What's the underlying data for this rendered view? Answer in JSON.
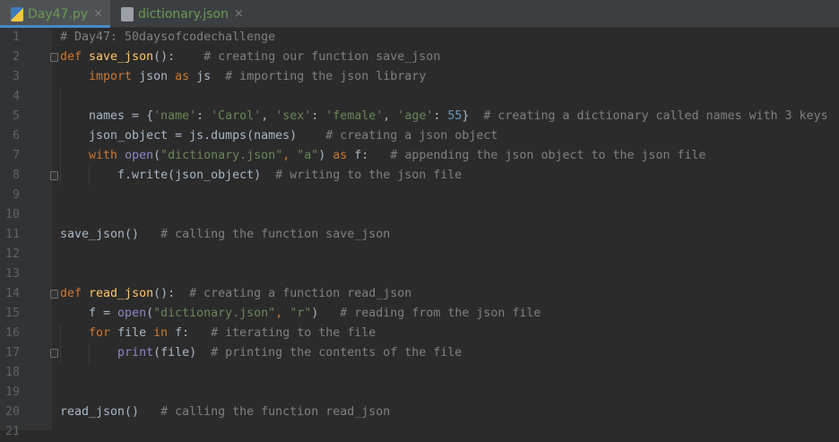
{
  "tabs": [
    {
      "label": "Day47.py",
      "icon": "python-file-icon",
      "active": true
    },
    {
      "label": "dictionary.json",
      "icon": "json-file-icon",
      "active": false
    }
  ],
  "close_glyph": "×",
  "colors": {
    "keyword": "#cc7832",
    "function": "#ffc66d",
    "string": "#6a8759",
    "comment": "#808080",
    "builtin": "#8888c6",
    "number": "#6897bb",
    "text": "#a9b7c6"
  },
  "lines": [
    {
      "n": "1",
      "tokens": [
        [
          "cm",
          "# Day47: 50daysofcodechallenge"
        ]
      ]
    },
    {
      "n": "2",
      "fold": true,
      "tokens": [
        [
          "kw",
          "def "
        ],
        [
          "fn",
          "save_json"
        ],
        [
          "tx",
          "():    "
        ],
        [
          "cm",
          "# creating our function save_json"
        ]
      ]
    },
    {
      "n": "3",
      "tokens": [
        [
          "tx",
          "    "
        ],
        [
          "kw",
          "import "
        ],
        [
          "tx",
          "json "
        ],
        [
          "kw",
          "as "
        ],
        [
          "tx",
          "js  "
        ],
        [
          "cm",
          "# importing the json library"
        ]
      ]
    },
    {
      "n": "4",
      "tokens": []
    },
    {
      "n": "5",
      "tokens": [
        [
          "tx",
          "    names = {"
        ],
        [
          "str",
          "'name'"
        ],
        [
          "tx",
          ": "
        ],
        [
          "str",
          "'Carol'"
        ],
        [
          "tx",
          ", "
        ],
        [
          "str",
          "'sex'"
        ],
        [
          "tx",
          ": "
        ],
        [
          "str",
          "'female'"
        ],
        [
          "tx",
          ", "
        ],
        [
          "str",
          "'age'"
        ],
        [
          "tx",
          ": "
        ],
        [
          "num",
          "55"
        ],
        [
          "tx",
          "}  "
        ],
        [
          "cm",
          "# creating a dictionary called names with 3 keys"
        ]
      ]
    },
    {
      "n": "6",
      "tokens": [
        [
          "tx",
          "    json_object = js.dumps(names)    "
        ],
        [
          "cm",
          "# creating a json object"
        ]
      ]
    },
    {
      "n": "7",
      "tokens": [
        [
          "tx",
          "    "
        ],
        [
          "kw",
          "with "
        ],
        [
          "bi",
          "open"
        ],
        [
          "tx",
          "("
        ],
        [
          "str",
          "\"dictionary.json\""
        ],
        [
          "kw",
          ", "
        ],
        [
          "str",
          "\"a\""
        ],
        [
          "tx",
          ") "
        ],
        [
          "kw",
          "as "
        ],
        [
          "tx",
          "f:   "
        ],
        [
          "cm",
          "# appending the json object to the json file"
        ]
      ]
    },
    {
      "n": "8",
      "fold": true,
      "tokens": [
        [
          "tx",
          "        f.write(json_object)  "
        ],
        [
          "cm",
          "# writing to the json file"
        ]
      ]
    },
    {
      "n": "9",
      "tokens": []
    },
    {
      "n": "10",
      "tokens": []
    },
    {
      "n": "11",
      "tokens": [
        [
          "tx",
          "save_json()   "
        ],
        [
          "cm",
          "# calling the function save_json"
        ]
      ]
    },
    {
      "n": "12",
      "tokens": []
    },
    {
      "n": "13",
      "tokens": []
    },
    {
      "n": "14",
      "fold": true,
      "tokens": [
        [
          "kw",
          "def "
        ],
        [
          "fn",
          "read_json"
        ],
        [
          "tx",
          "():  "
        ],
        [
          "cm",
          "# creating a function read_json"
        ]
      ]
    },
    {
      "n": "15",
      "tokens": [
        [
          "tx",
          "    f = "
        ],
        [
          "bi",
          "open"
        ],
        [
          "tx",
          "("
        ],
        [
          "str",
          "\"dictionary.json\""
        ],
        [
          "kw",
          ", "
        ],
        [
          "str",
          "\"r\""
        ],
        [
          "tx",
          ")   "
        ],
        [
          "cm",
          "# reading from the json file"
        ]
      ]
    },
    {
      "n": "16",
      "tokens": [
        [
          "tx",
          "    "
        ],
        [
          "kw",
          "for "
        ],
        [
          "tx",
          "file "
        ],
        [
          "kw",
          "in "
        ],
        [
          "tx",
          "f:   "
        ],
        [
          "cm",
          "# iterating to the file"
        ]
      ]
    },
    {
      "n": "17",
      "fold": true,
      "tokens": [
        [
          "tx",
          "        "
        ],
        [
          "bi",
          "print"
        ],
        [
          "tx",
          "(file)  "
        ],
        [
          "cm",
          "# printing the contents of the file"
        ]
      ]
    },
    {
      "n": "18",
      "tokens": []
    },
    {
      "n": "19",
      "tokens": []
    },
    {
      "n": "20",
      "tokens": [
        [
          "tx",
          "read_json()   "
        ],
        [
          "cm",
          "# calling the function read_json"
        ]
      ]
    },
    {
      "n": "21",
      "tokens": []
    }
  ]
}
